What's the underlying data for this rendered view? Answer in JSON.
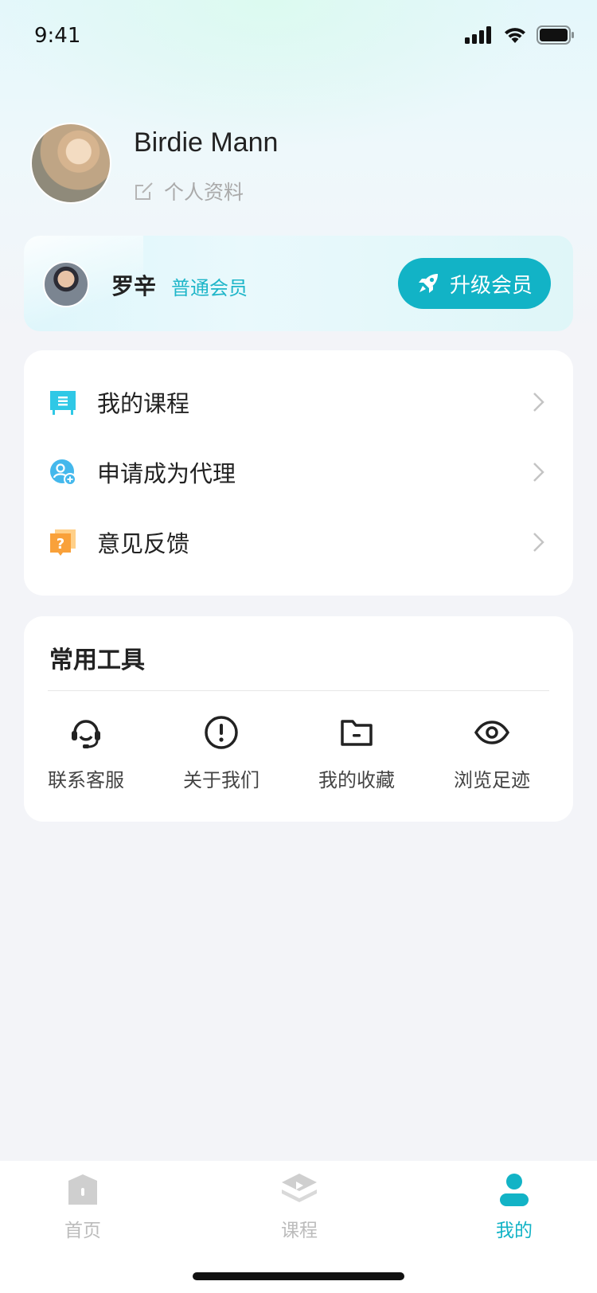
{
  "status_bar": {
    "time": "9:41"
  },
  "profile": {
    "name": "Birdie Mann",
    "edit_label": "个人资料"
  },
  "member": {
    "name": "罗辛",
    "level": "普通会员",
    "upgrade_label": "升级会员",
    "accent_color": "#12b3c6"
  },
  "menu": {
    "items": [
      {
        "label": "我的课程",
        "icon": "course-board-icon"
      },
      {
        "label": "申请成为代理",
        "icon": "add-user-icon"
      },
      {
        "label": "意见反馈",
        "icon": "feedback-question-icon"
      }
    ]
  },
  "tools": {
    "title": "常用工具",
    "items": [
      {
        "label": "联系客服",
        "icon": "headset-icon"
      },
      {
        "label": "关于我们",
        "icon": "info-circle-icon"
      },
      {
        "label": "我的收藏",
        "icon": "folder-icon"
      },
      {
        "label": "浏览足迹",
        "icon": "eye-icon"
      }
    ]
  },
  "tabbar": {
    "items": [
      {
        "label": "首页",
        "icon": "home-icon",
        "active": false
      },
      {
        "label": "课程",
        "icon": "course-icon",
        "active": false
      },
      {
        "label": "我的",
        "icon": "profile-icon",
        "active": true
      }
    ],
    "active_color": "#12b3c6",
    "inactive_color": "#bcbcbc"
  }
}
